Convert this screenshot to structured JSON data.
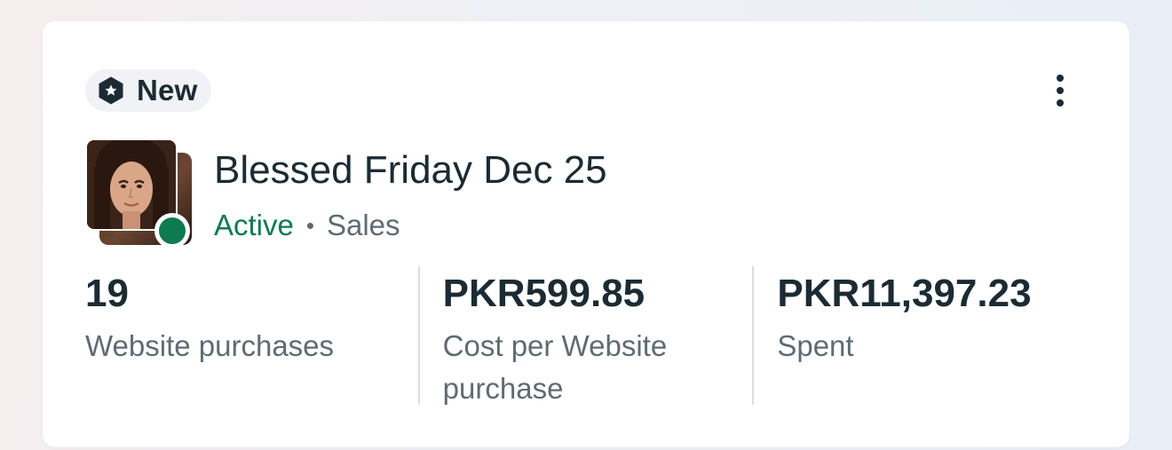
{
  "badge": {
    "label": "New",
    "icon": "shield-star-icon"
  },
  "menu": {
    "icon": "more-vertical-icon"
  },
  "campaign": {
    "title": "Blessed Friday Dec 25",
    "status": "Active",
    "separator": "•",
    "objective": "Sales",
    "status_color": "#0e7a4f",
    "thumbnail": "ad-creative-thumbnail"
  },
  "metrics": [
    {
      "value": "19",
      "label": "Website purchases"
    },
    {
      "value": "PKR599.85",
      "label": "Cost per Website purchase"
    },
    {
      "value": "PKR11,397.23",
      "label": "Spent"
    }
  ]
}
